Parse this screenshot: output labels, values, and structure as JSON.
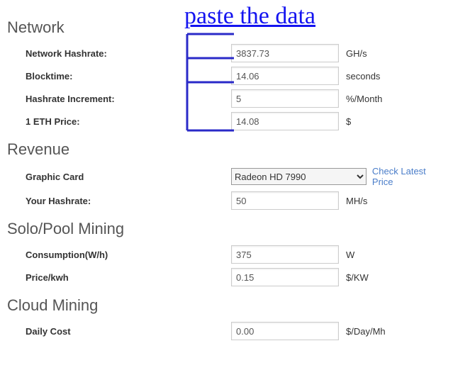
{
  "annotation": {
    "title": "paste the data"
  },
  "network": {
    "heading": "Network",
    "hashrate": {
      "label": "Network Hashrate:",
      "value": "3837.73",
      "unit": "GH/s"
    },
    "blocktime": {
      "label": "Blocktime:",
      "value": "14.06",
      "unit": "seconds"
    },
    "increment": {
      "label": "Hashrate Increment:",
      "value": "5",
      "unit": "%/Month"
    },
    "ethprice": {
      "label": "1 ETH Price:",
      "value": "14.08",
      "unit": "$"
    }
  },
  "revenue": {
    "heading": "Revenue",
    "gpu": {
      "label": "Graphic Card",
      "value": "Radeon HD 7990",
      "link": "Check Latest Price"
    },
    "yourhash": {
      "label": "Your Hashrate:",
      "value": "50",
      "unit": "MH/s"
    }
  },
  "solopool": {
    "heading": "Solo/Pool Mining",
    "consumption": {
      "label": "Consumption(W/h)",
      "value": "375",
      "unit": "W"
    },
    "pricekwh": {
      "label": "Price/kwh",
      "value": "0.15",
      "unit": "$/KW"
    }
  },
  "cloud": {
    "heading": "Cloud Mining",
    "dailycost": {
      "label": "Daily Cost",
      "value": "0.00",
      "unit": "$/Day/Mh"
    }
  }
}
